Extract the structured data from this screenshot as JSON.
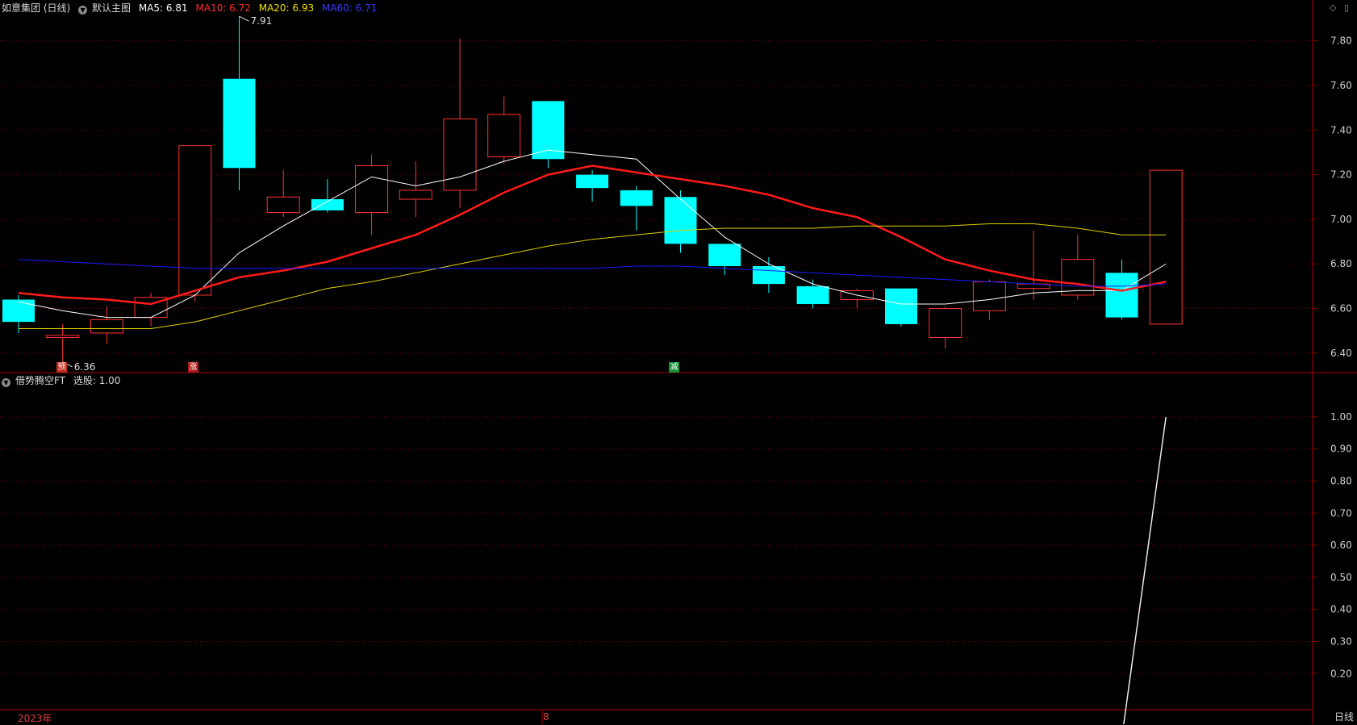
{
  "header": {
    "stock_label": "如意集团 (日线)",
    "main_chart_label": "默认主图",
    "ma5": {
      "label": "MA5: 6.81",
      "color": "#ffffff"
    },
    "ma10": {
      "label": "MA10: 6.72",
      "color": "#ff2a2a"
    },
    "ma20": {
      "label": "MA20: 6.93",
      "color": "#f0e000"
    },
    "ma60": {
      "label": "MA60: 6.71",
      "color": "#2020ff"
    }
  },
  "sub_header": {
    "indicator_label": "借势腾空FT",
    "value_label": "选股: 1.00"
  },
  "toolbar": {
    "diamond_icon": "◇",
    "panel_icon": "▯"
  },
  "tags": {
    "pre": "预",
    "up": "涨",
    "down": "减"
  },
  "bottom": {
    "year_label": "2023年",
    "month_label": "8",
    "period_label": "日线"
  },
  "chart_data": [
    {
      "type": "candlestick",
      "ylim": [
        6.32,
        7.9
      ],
      "yticks": [
        "7.80",
        "7.60",
        "7.40",
        "7.20",
        "7.00",
        "6.80",
        "6.60",
        "6.40"
      ],
      "annotations": [
        {
          "text": "7.91",
          "index": 5,
          "value": 7.91
        },
        {
          "text": "6.36",
          "index": 1,
          "value": 6.36
        }
      ],
      "candles": [
        {
          "o": 6.64,
          "c": 6.54,
          "h": 6.66,
          "l": 6.49
        },
        {
          "o": 6.47,
          "c": 6.48,
          "h": 6.53,
          "l": 6.36
        },
        {
          "o": 6.49,
          "c": 6.55,
          "h": 6.61,
          "l": 6.44
        },
        {
          "o": 6.56,
          "c": 6.65,
          "h": 6.67,
          "l": 6.52
        },
        {
          "o": 6.66,
          "c": 7.33,
          "h": 7.33,
          "l": 6.63
        },
        {
          "o": 7.63,
          "c": 7.23,
          "h": 7.91,
          "l": 7.13
        },
        {
          "o": 7.03,
          "c": 7.1,
          "h": 7.22,
          "l": 7.01
        },
        {
          "o": 7.09,
          "c": 7.04,
          "h": 7.18,
          "l": 7.03
        },
        {
          "o": 7.03,
          "c": 7.24,
          "h": 7.29,
          "l": 6.93
        },
        {
          "o": 7.09,
          "c": 7.13,
          "h": 7.26,
          "l": 7.01
        },
        {
          "o": 7.13,
          "c": 7.45,
          "h": 7.81,
          "l": 7.05
        },
        {
          "o": 7.28,
          "c": 7.47,
          "h": 7.55,
          "l": 7.25
        },
        {
          "o": 7.53,
          "c": 7.27,
          "h": 7.53,
          "l": 7.23
        },
        {
          "o": 7.2,
          "c": 7.14,
          "h": 7.22,
          "l": 7.08
        },
        {
          "o": 7.13,
          "c": 7.06,
          "h": 7.15,
          "l": 6.95
        },
        {
          "o": 7.1,
          "c": 6.89,
          "h": 7.13,
          "l": 6.85
        },
        {
          "o": 6.89,
          "c": 6.79,
          "h": 6.89,
          "l": 6.75
        },
        {
          "o": 6.79,
          "c": 6.71,
          "h": 6.83,
          "l": 6.67
        },
        {
          "o": 6.7,
          "c": 6.62,
          "h": 6.73,
          "l": 6.6
        },
        {
          "o": 6.64,
          "c": 6.68,
          "h": 6.69,
          "l": 6.6
        },
        {
          "o": 6.69,
          "c": 6.53,
          "h": 6.69,
          "l": 6.52
        },
        {
          "o": 6.47,
          "c": 6.6,
          "h": 6.61,
          "l": 6.42
        },
        {
          "o": 6.59,
          "c": 6.72,
          "h": 6.73,
          "l": 6.55
        },
        {
          "o": 6.69,
          "c": 6.71,
          "h": 6.95,
          "l": 6.64
        },
        {
          "o": 6.66,
          "c": 6.82,
          "h": 6.93,
          "l": 6.64
        },
        {
          "o": 6.76,
          "c": 6.56,
          "h": 6.82,
          "l": 6.55
        },
        {
          "o": 6.53,
          "c": 7.22,
          "h": 7.22,
          "l": 6.53
        }
      ],
      "series": [
        {
          "name": "MA5",
          "color": "#ffffff",
          "width": 1,
          "values": [
            6.63,
            6.59,
            6.56,
            6.56,
            6.66,
            6.85,
            6.97,
            7.08,
            7.19,
            7.15,
            7.19,
            7.26,
            7.31,
            7.29,
            7.27,
            7.09,
            6.92,
            6.8,
            6.71,
            6.66,
            6.62,
            6.62,
            6.64,
            6.67,
            6.68,
            6.68,
            6.8
          ]
        },
        {
          "name": "MA10",
          "color": "#ff1a1a",
          "width": 2.5,
          "values": [
            6.67,
            6.65,
            6.64,
            6.62,
            6.68,
            6.74,
            6.77,
            6.81,
            6.87,
            6.93,
            7.02,
            7.12,
            7.2,
            7.24,
            7.21,
            7.18,
            7.15,
            7.11,
            7.05,
            7.01,
            6.92,
            6.82,
            6.77,
            6.73,
            6.71,
            6.68,
            6.72
          ]
        },
        {
          "name": "MA20",
          "color": "#e0d000",
          "width": 1,
          "values": [
            6.51,
            6.51,
            6.51,
            6.51,
            6.54,
            6.59,
            6.64,
            6.69,
            6.72,
            6.76,
            6.8,
            6.84,
            6.88,
            6.91,
            6.93,
            6.95,
            6.96,
            6.96,
            6.96,
            6.97,
            6.97,
            6.97,
            6.98,
            6.98,
            6.96,
            6.93,
            6.93
          ]
        },
        {
          "name": "MA60",
          "color": "#1a1aff",
          "width": 1,
          "values": [
            6.82,
            6.81,
            6.8,
            6.79,
            6.78,
            6.78,
            6.78,
            6.78,
            6.78,
            6.78,
            6.78,
            6.78,
            6.78,
            6.78,
            6.79,
            6.79,
            6.78,
            6.77,
            6.76,
            6.75,
            6.74,
            6.73,
            6.72,
            6.71,
            6.7,
            6.7,
            6.71
          ]
        }
      ]
    },
    {
      "type": "line",
      "ylim": [
        0.07,
        1.03
      ],
      "yticks": [
        "1.00",
        "0.90",
        "0.80",
        "0.70",
        "0.60",
        "0.50",
        "0.40",
        "0.30",
        "0.20"
      ],
      "series": [
        {
          "name": "选股",
          "color": "#e8e8e8",
          "values": [
            0,
            0,
            0,
            0,
            0,
            0,
            0,
            0,
            0,
            0,
            0,
            0,
            0,
            0,
            0,
            0,
            0,
            0,
            0,
            0,
            0,
            0,
            0,
            0,
            0,
            0,
            1
          ]
        }
      ]
    }
  ],
  "colors": {
    "up": "#ff3232",
    "down": "#00ffff",
    "grid": "#7a0000",
    "axis": "#aa0000"
  }
}
